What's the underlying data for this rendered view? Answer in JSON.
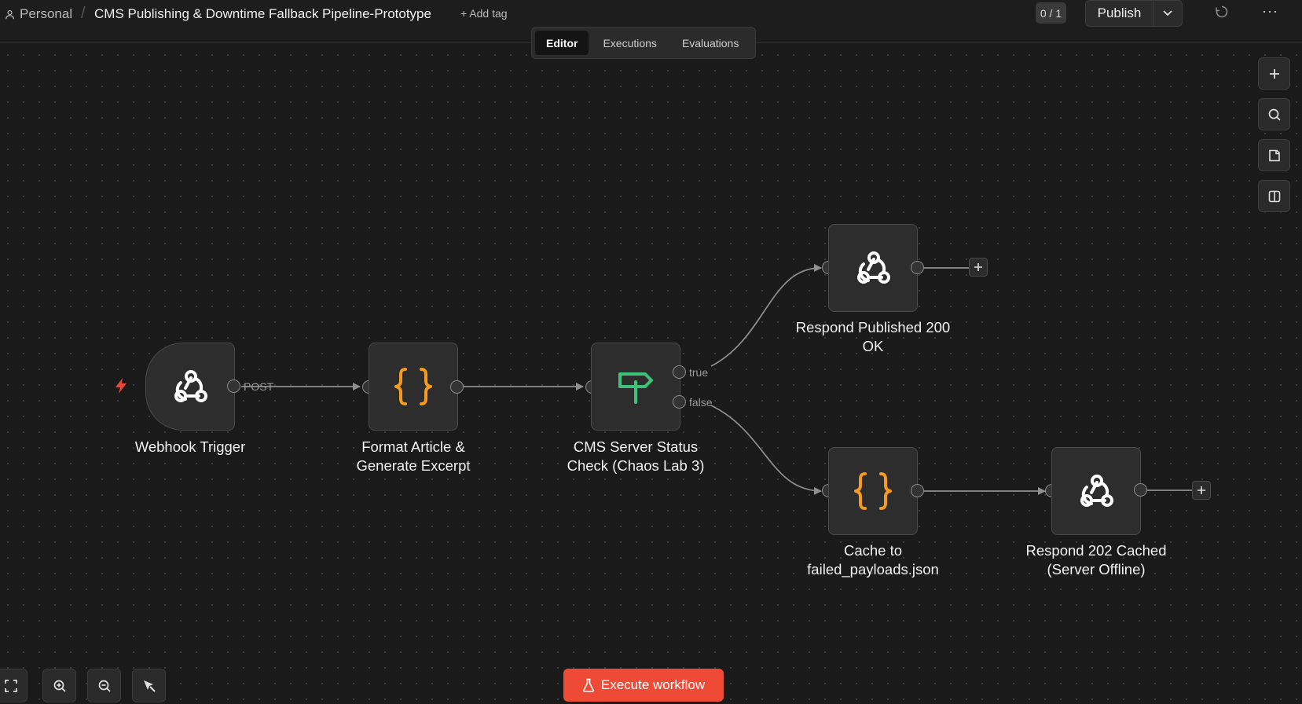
{
  "header": {
    "workspace": "Personal",
    "workflow_title": "CMS Publishing & Downtime Fallback Pipeline-Prototype",
    "add_tag": "+ Add tag",
    "counter": "0 / 1",
    "publish_label": "Publish",
    "more_label": "···"
  },
  "tabs": [
    {
      "label": "Editor",
      "active": true
    },
    {
      "label": "Executions",
      "active": false
    },
    {
      "label": "Evaluations",
      "active": false
    }
  ],
  "nodes": {
    "webhook": {
      "label": "Webhook Trigger",
      "icon": "webhook-icon",
      "output_label": "POST"
    },
    "format": {
      "label1": "Format Article &",
      "label2": "Generate Excerpt",
      "icon": "code-braces-icon"
    },
    "status": {
      "label1": "CMS Server Status",
      "label2": "Check (Chaos Lab 3)",
      "icon": "signpost-icon",
      "true_label": "true",
      "false_label": "false"
    },
    "respond200": {
      "label1": "Respond Published 200",
      "label2": "OK",
      "icon": "webhook-icon"
    },
    "cache": {
      "label1": "Cache to",
      "label2": "failed_payloads.json",
      "icon": "code-braces-icon"
    },
    "respond202": {
      "label1": "Respond 202 Cached",
      "label2": "(Server Offline)",
      "icon": "webhook-icon"
    }
  },
  "execute_label": "Execute workflow",
  "colors": {
    "accent": "#ef4a35",
    "code": "#f59b20",
    "switch": "#3ec27a",
    "bolt": "#e5483a"
  }
}
